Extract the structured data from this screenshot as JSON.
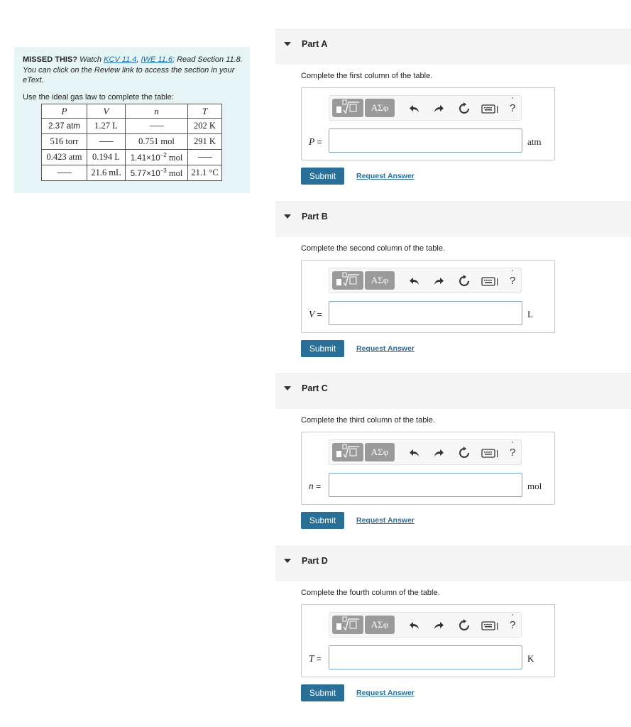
{
  "panel": {
    "missed_label": "MISSED THIS?",
    "watch_text": " Watch ",
    "link_kcv": "KCV 11.4",
    "comma": ", ",
    "link_iwe": "IWE 11.6",
    "read_text": "; Read Section 11.8. You can click on the Review link to access the section in your eText.",
    "use_law_text": "Use the ideal gas law to complete the table:",
    "table": {
      "headers": [
        "P",
        "V",
        "n",
        "T"
      ],
      "rows": [
        [
          "2.37 atm",
          "1.27 L",
          "",
          "202 K"
        ],
        [
          "516 torr",
          "",
          "0.751 mol",
          "291 K"
        ],
        [
          "0.423 atm",
          "0.194 L",
          "1.41×10",
          ""
        ],
        [
          "",
          "21.6 mL",
          "5.77×10",
          "21.1 °C"
        ]
      ],
      "exp_row3": "−2",
      "exp_row4": "−3",
      "mol_suffix": " mol"
    }
  },
  "toolbar": {
    "greek_label": "ΑΣφ",
    "help_label": "?"
  },
  "parts": [
    {
      "title": "Part A",
      "instruction": "Complete the first column of the table.",
      "variable": "P",
      "equals": " =",
      "unit": "atm",
      "input_value": ""
    },
    {
      "title": "Part B",
      "instruction": "Complete the second column of the table.",
      "variable": "V",
      "equals": " =",
      "unit": "L",
      "input_value": ""
    },
    {
      "title": "Part C",
      "instruction": "Complete the third column of the table.",
      "variable": "n",
      "equals": " =",
      "unit": "mol",
      "input_value": ""
    },
    {
      "title": "Part D",
      "instruction": "Complete the fourth column of the table.",
      "variable": "T",
      "equals": " =",
      "unit": "K",
      "input_value": ""
    }
  ],
  "buttons": {
    "submit_label": "Submit",
    "request_label": "Request Answer"
  }
}
